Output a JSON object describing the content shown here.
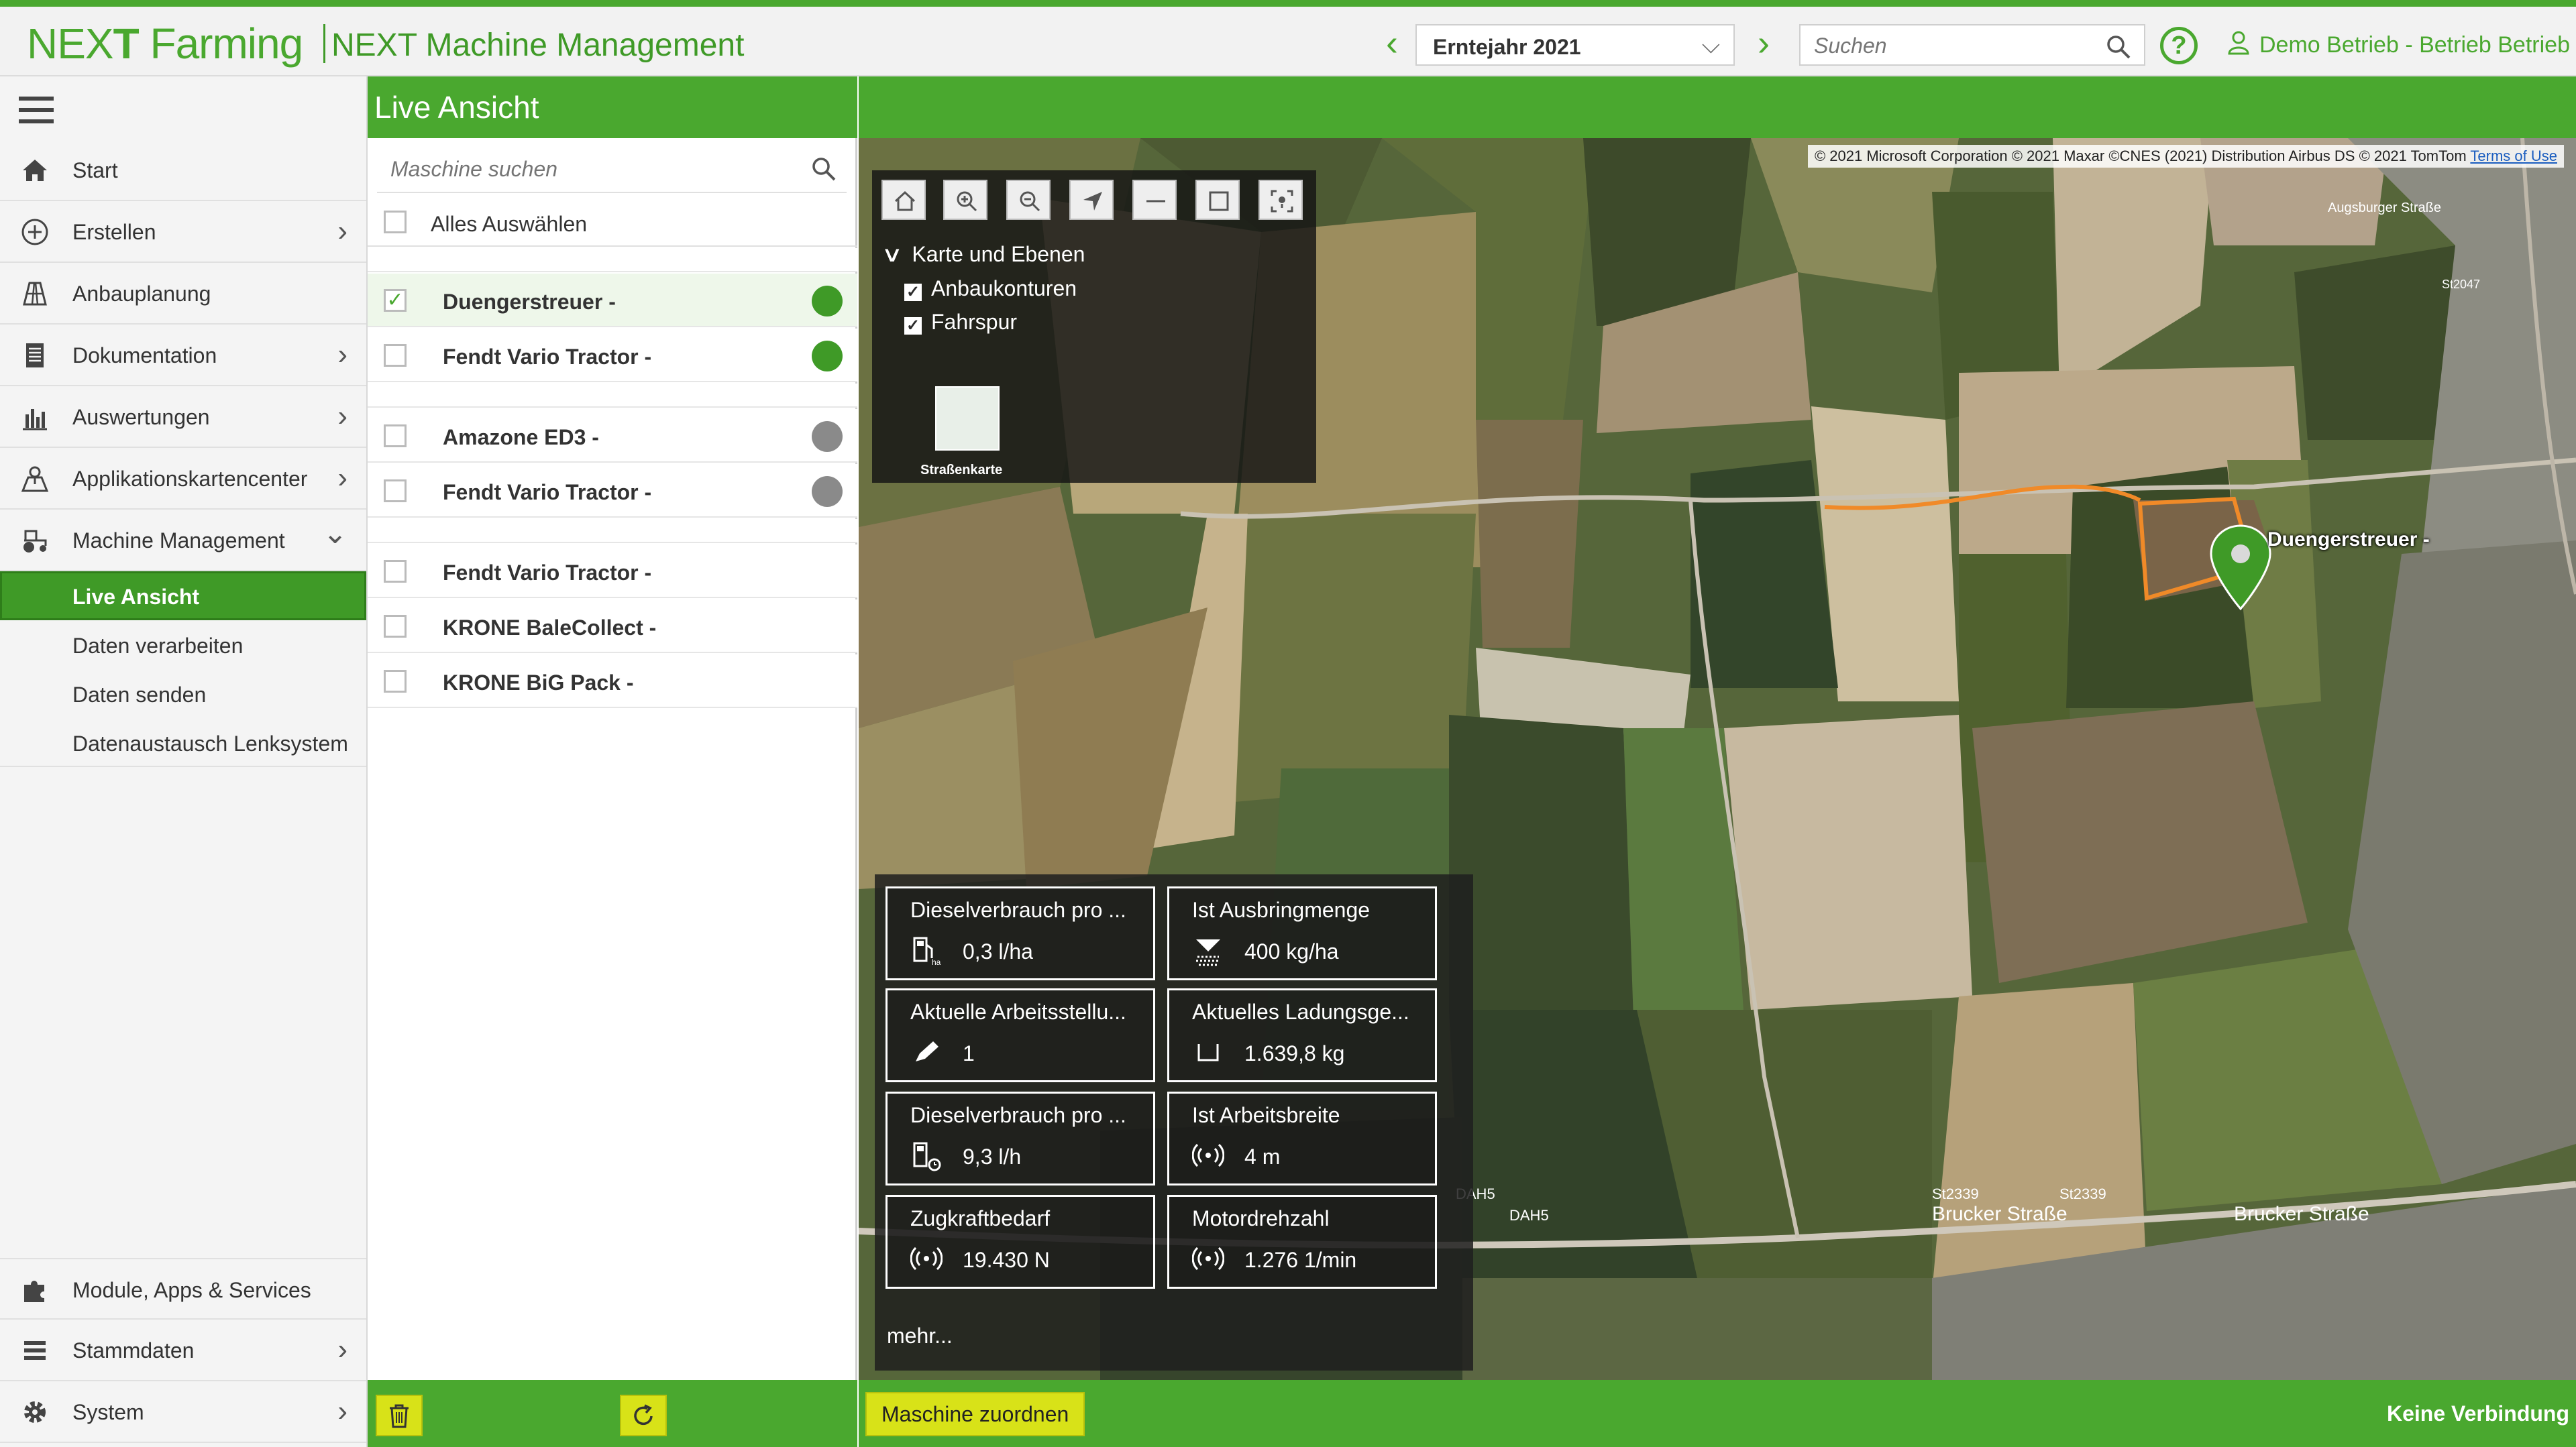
{
  "header": {
    "logo_next": "NEX",
    "logo_t": "T",
    "logo_farming": " Farming",
    "app_title": "NEXT Machine Management",
    "prev_label": "‹",
    "next_label": "›",
    "year_value": "Erntejahr 2021",
    "search_placeholder": "Suchen",
    "help_label": "?",
    "user_label": "Demo Betrieb - Betrieb Betrieb"
  },
  "sidebar": {
    "items": [
      {
        "label": "Start",
        "icon": "home-icon"
      },
      {
        "label": "Erstellen",
        "icon": "plus-circle-icon",
        "chevron": "›"
      },
      {
        "label": "Anbauplanung",
        "icon": "field-plan-icon"
      },
      {
        "label": "Dokumentation",
        "icon": "document-icon",
        "chevron": "›"
      },
      {
        "label": "Auswertungen",
        "icon": "bar-chart-icon",
        "chevron": "›"
      },
      {
        "label": "Applikationskartencenter",
        "icon": "map-app-icon",
        "chevron": "›"
      },
      {
        "label": "Machine Management",
        "icon": "tractor-icon",
        "chevron": "⌄"
      }
    ],
    "subitems": [
      {
        "label": "Live Ansicht",
        "active": true
      },
      {
        "label": "Daten verarbeiten"
      },
      {
        "label": "Daten senden"
      },
      {
        "label": "Datenaustausch Lenksystem"
      }
    ],
    "bottom_items": [
      {
        "label": "Module, Apps & Services",
        "icon": "puzzle-icon"
      },
      {
        "label": "Stammdaten",
        "icon": "list-icon",
        "chevron": "›"
      },
      {
        "label": "System",
        "icon": "gear-icon",
        "chevron": "›"
      }
    ]
  },
  "machine_panel": {
    "title": "Live Ansicht",
    "search_placeholder": "Maschine suchen",
    "select_all": "Alles Auswählen",
    "groups": [
      [
        {
          "name": "Duengerstreuer -",
          "checked": true,
          "status": "online",
          "status_color": "#3f9a27"
        },
        {
          "name": "Fendt Vario Tractor -",
          "checked": false,
          "status": "online",
          "status_color": "#3f9a27"
        }
      ],
      [
        {
          "name": "Amazone ED3 -",
          "checked": false,
          "status": "offline",
          "status_color": "#8a8a8a"
        },
        {
          "name": "Fendt Vario Tractor -",
          "checked": false,
          "status": "offline",
          "status_color": "#8a8a8a"
        }
      ],
      [
        {
          "name": "Fendt Vario Tractor -",
          "checked": false,
          "status": "none"
        },
        {
          "name": "KRONE BaleCollect -",
          "checked": false,
          "status": "none"
        },
        {
          "name": "KRONE BiG Pack -",
          "checked": false,
          "status": "none"
        }
      ]
    ],
    "check_mark": "✓"
  },
  "map": {
    "copyright": "© 2021 Microsoft Corporation © 2021 Maxar ©CNES (2021) Distribution Airbus DS © 2021 TomTom",
    "terms": "Terms of Use",
    "toolbar": [
      "home-icon",
      "zoom-in-icon",
      "zoom-out-icon",
      "locate-icon",
      "line-icon",
      "rectangle-icon",
      "fullscreen-pin-icon"
    ],
    "layers_title": "Karte und Ebenen",
    "layers": [
      {
        "label": "Anbaukonturen",
        "checked": true
      },
      {
        "label": "Fahrspur",
        "checked": true
      }
    ],
    "layer_check": "✓",
    "basemap_label": "Straßenkarte",
    "pin_label": "Duengerstreuer -",
    "sensors": [
      {
        "title": "Dieselverbrauch pro ...",
        "value": "0,3 l/ha",
        "icon": "fuel-ha-icon"
      },
      {
        "title": "Ist Ausbringmenge",
        "value": "400 kg/ha",
        "icon": "spreader-icon"
      },
      {
        "title": "Aktuelle Arbeitsstellu...",
        "value": "1",
        "icon": "pen-icon"
      },
      {
        "title": "Aktuelles Ladungsge...",
        "value": "1.639,8 kg",
        "icon": "load-icon"
      },
      {
        "title": "Dieselverbrauch pro ...",
        "value": "9,3 l/h",
        "icon": "fuel-time-icon"
      },
      {
        "title": "Ist Arbeitsbreite",
        "value": "4 m",
        "icon": "signal-icon"
      },
      {
        "title": "Zugkraftbedarf",
        "value": "19.430 N",
        "icon": "signal-icon"
      },
      {
        "title": "Motordrehzahl",
        "value": "1.276 1/min",
        "icon": "signal-icon"
      }
    ],
    "more_label": "mehr...",
    "road_labels": [
      "Brucker Straße",
      "Brucker Straße",
      "DAH5",
      "DAH5",
      "St2339",
      "St2339",
      "St2047",
      "Augsburger Straße"
    ],
    "colors": {
      "track": "#f08a28",
      "pin": "#3f9a27"
    }
  },
  "footer": {
    "delete_icon": "trash-icon",
    "refresh_icon": "refresh-icon",
    "assign_label": "Maschine zuordnen",
    "connection_status": "Keine Verbindung"
  },
  "colors": {
    "brand": "#4aa82f",
    "accent_button": "#d8e218"
  }
}
